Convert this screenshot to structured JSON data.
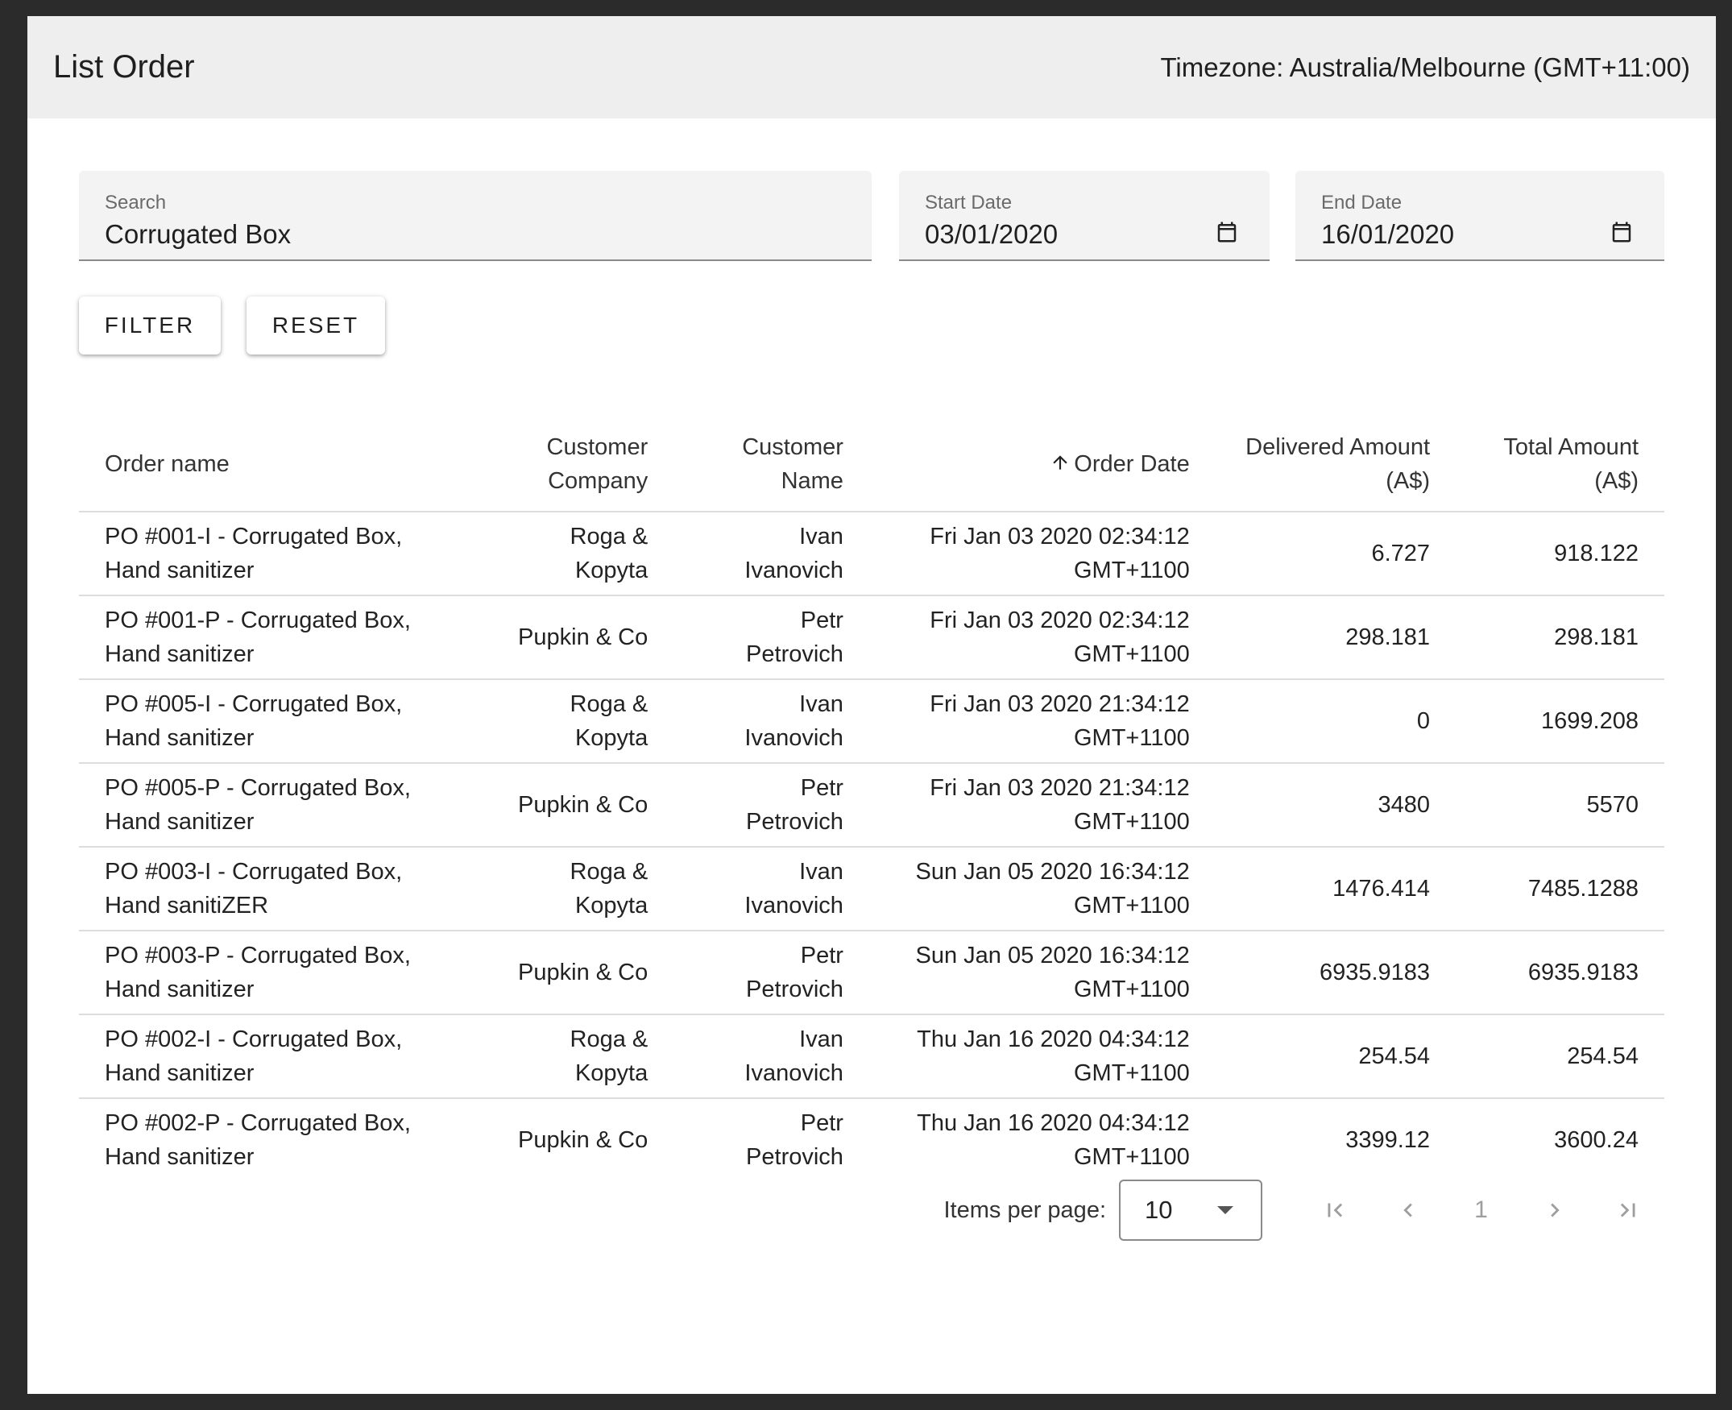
{
  "header": {
    "title": "List Order",
    "timezone": "Timezone: Australia/Melbourne (GMT+11:00)"
  },
  "filters": {
    "search": {
      "label": "Search",
      "value": "Corrugated Box"
    },
    "start_date": {
      "label": "Start Date",
      "value": "03/01/2020"
    },
    "end_date": {
      "label": "End Date",
      "value": "16/01/2020"
    }
  },
  "buttons": {
    "filter": "FILTER",
    "reset": "RESET"
  },
  "table": {
    "headers": {
      "order_name": "Order name",
      "customer_company": [
        "Customer",
        "Company"
      ],
      "customer_name": [
        "Customer",
        "Name"
      ],
      "order_date": "Order Date",
      "delivered_amount": [
        "Delivered Amount",
        "(A$)"
      ],
      "total_amount": [
        "Total Amount",
        "(A$)"
      ]
    },
    "sort": {
      "column": "Order Date",
      "direction": "ascending",
      "icon": "arrow-up-icon"
    },
    "rows": [
      {
        "order": [
          "PO #001-I - Corrugated Box,",
          "Hand sanitizer"
        ],
        "company": "Roga & Kopyta",
        "name": [
          "Ivan",
          "Ivanovich"
        ],
        "date": [
          "Fri Jan 03 2020 02:34:12",
          "GMT+1100"
        ],
        "delivered": "6.727",
        "total": "918.122"
      },
      {
        "order": [
          "PO #001-P - Corrugated Box,",
          "Hand sanitizer"
        ],
        "company": "Pupkin & Co",
        "name": [
          "Petr Petrovich"
        ],
        "date": [
          "Fri Jan 03 2020 02:34:12",
          "GMT+1100"
        ],
        "delivered": "298.181",
        "total": "298.181"
      },
      {
        "order": [
          "PO #005-I - Corrugated Box,",
          "Hand sanitizer"
        ],
        "company": "Roga & Kopyta",
        "name": [
          "Ivan",
          "Ivanovich"
        ],
        "date": [
          "Fri Jan 03 2020 21:34:12",
          "GMT+1100"
        ],
        "delivered": "0",
        "total": "1699.208"
      },
      {
        "order": [
          "PO #005-P - Corrugated Box,",
          "Hand sanitizer"
        ],
        "company": "Pupkin & Co",
        "name": [
          "Petr Petrovich"
        ],
        "date": [
          "Fri Jan 03 2020 21:34:12",
          "GMT+1100"
        ],
        "delivered": "3480",
        "total": "5570"
      },
      {
        "order": [
          "PO #003-I - Corrugated Box,",
          "Hand sanitiZER"
        ],
        "company": "Roga & Kopyta",
        "name": [
          "Ivan",
          "Ivanovich"
        ],
        "date": [
          "Sun Jan 05 2020 16:34:12",
          "GMT+1100"
        ],
        "delivered": "1476.414",
        "total": "7485.1288"
      },
      {
        "order": [
          "PO #003-P - Corrugated Box,",
          "Hand sanitizer"
        ],
        "company": "Pupkin & Co",
        "name": [
          "Petr Petrovich"
        ],
        "date": [
          "Sun Jan 05 2020 16:34:12",
          "GMT+1100"
        ],
        "delivered": "6935.9183",
        "total": "6935.9183"
      },
      {
        "order": [
          "PO #002-I - Corrugated Box,",
          "Hand sanitizer"
        ],
        "company": "Roga & Kopyta",
        "name": [
          "Ivan",
          "Ivanovich"
        ],
        "date": [
          "Thu Jan 16 2020 04:34:12",
          "GMT+1100"
        ],
        "delivered": "254.54",
        "total": "254.54"
      },
      {
        "order": [
          "PO #002-P - Corrugated Box,",
          "Hand sanitizer"
        ],
        "company": "Pupkin & Co",
        "name": [
          "Petr Petrovich"
        ],
        "date": [
          "Thu Jan 16 2020 04:34:12",
          "GMT+1100"
        ],
        "delivered": "3399.12",
        "total": "3600.24"
      }
    ]
  },
  "paginator": {
    "items_per_page_label": "Items per page:",
    "items_per_page": "10",
    "current_page": "1",
    "icons": [
      "first-page-icon",
      "previous-page-icon",
      "next-page-icon",
      "last-page-icon"
    ]
  }
}
